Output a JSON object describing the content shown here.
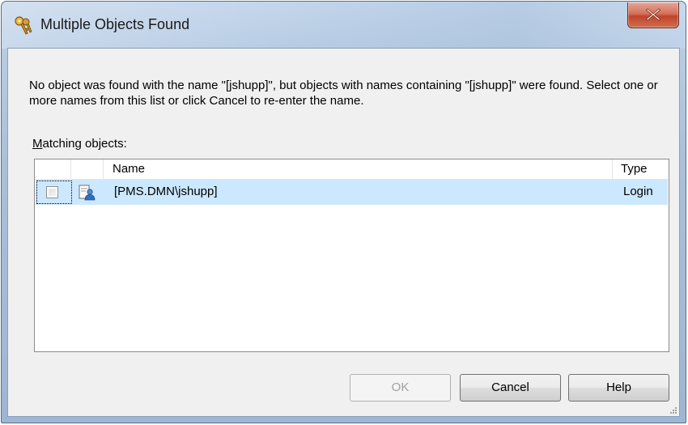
{
  "window": {
    "title": "Multiple Objects Found",
    "icon": "keys-icon"
  },
  "message": "No object was found with the name \"[jshupp]\", but objects with names containing \"[jshupp]\" were found.  Select one or more names from this list or click Cancel to re-enter the name.",
  "list": {
    "label_prefix": "M",
    "label_rest": "atching objects:",
    "columns": {
      "name": "Name",
      "type": "Type"
    },
    "rows": [
      {
        "checked": false,
        "icon": "login-user-icon",
        "name": "[PMS.DMN\\jshupp]",
        "type": "Login"
      }
    ]
  },
  "buttons": {
    "ok": "OK",
    "cancel": "Cancel",
    "help": "Help"
  },
  "colors": {
    "selection": "#cce8ff",
    "close_button": "#c2432b"
  }
}
